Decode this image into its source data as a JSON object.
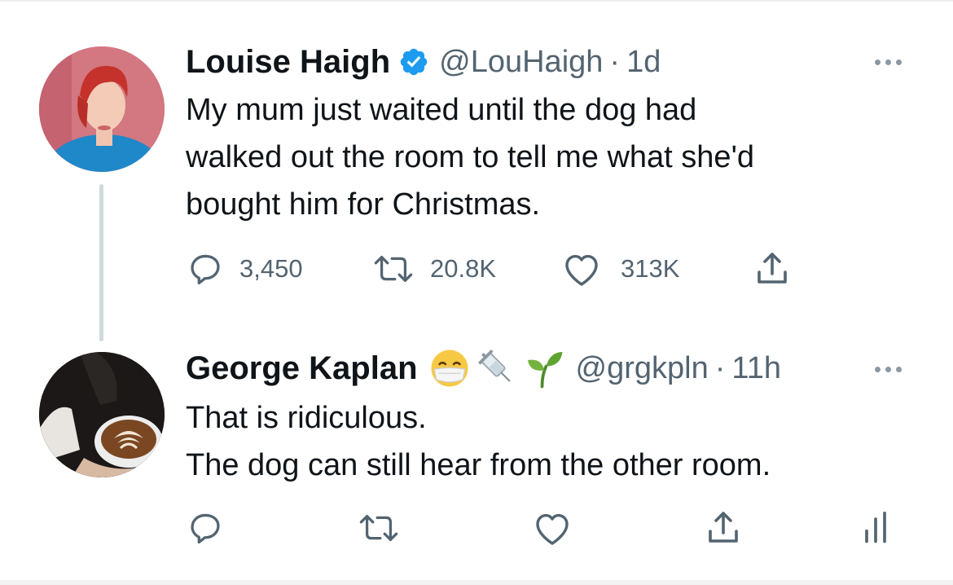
{
  "tweets": [
    {
      "name": "Louise Haigh",
      "verified": true,
      "handle": "@LouHaigh",
      "separator": "·",
      "time": "1d",
      "text_lines": [
        "My mum just waited until the dog had",
        "walked out the room to tell me what she'd",
        "bought him for Christmas."
      ],
      "counts": {
        "replies": "3,450",
        "retweets": "20.8K",
        "likes": "313K"
      }
    },
    {
      "name": "George Kaplan",
      "name_emojis": [
        "mask-face-emoji",
        "syringe-emoji",
        "seedling-emoji"
      ],
      "handle": "@grgkpln",
      "separator": "·",
      "time": "11h",
      "text_lines": [
        "That is ridiculous.",
        "The dog can still hear from the other room."
      ]
    }
  ],
  "colors": {
    "verified": "#1d9bf0",
    "secondary_text": "#536471",
    "primary_text": "#0f1419",
    "thread_line": "#cfd9de"
  }
}
